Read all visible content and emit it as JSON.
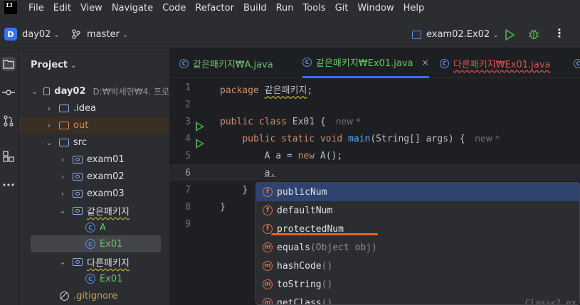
{
  "app_logo": "IJ",
  "menu": [
    "File",
    "Edit",
    "View",
    "Navigate",
    "Code",
    "Refactor",
    "Build",
    "Run",
    "Tools",
    "Git",
    "Window",
    "Help"
  ],
  "toolbar": {
    "project_badge": "D",
    "project_name": "day02",
    "branch_name": "master",
    "run_config": "exam02.Ex02",
    "more_glyph": "⋮"
  },
  "panel": {
    "title": "Project"
  },
  "tree": {
    "root": {
      "name": "day02",
      "path": "D:₩박세현₩4. 프로"
    },
    "idea": ".idea",
    "out": "out",
    "src": "src",
    "exam01": "exam01",
    "exam02": "exam02",
    "exam03": "exam03",
    "pkg_same": "같은패키지",
    "class_a": "A",
    "class_ex01": "Ex01",
    "pkg_other": "다른패키지",
    "class_ex01_other": "Ex01",
    "gitignore": ".gitignore"
  },
  "tabs": [
    {
      "label": "같은패키지₩A.java"
    },
    {
      "label": "같은패키지₩Ex01.java",
      "close": "×"
    },
    {
      "label": "다른패키지₩Ex01.java"
    }
  ],
  "lines": [
    "1",
    "2",
    "3",
    "4",
    "5",
    "6",
    "7",
    "8",
    "9"
  ],
  "code": {
    "l1_kw": "package",
    "l1_rest": "같은패키지",
    "l1_end": ";",
    "l3_kw": "public class",
    "l3_rest": " Ex01 {",
    "l3_hint": "new *",
    "l4_kw": "public static void",
    "l4_fn": "main",
    "l4_rest": "(String[] args) {",
    "l4_hint": "new *",
    "l5_a": "A a = ",
    "l5_kw": "new",
    "l5_rest": " A();",
    "l6": "a.",
    "l7": "}",
    "l8": "}"
  },
  "completion": [
    {
      "icon": "f",
      "name": "publicNum",
      "params": "",
      "type": ""
    },
    {
      "icon": "f",
      "name": "defaultNum",
      "params": "",
      "type": ""
    },
    {
      "icon": "f",
      "name": "protectedNum",
      "params": "",
      "type": ""
    },
    {
      "icon": "m",
      "name": "equals",
      "params": "(Object obj)",
      "type": ""
    },
    {
      "icon": "m",
      "name": "hashCode",
      "params": "()",
      "type": ""
    },
    {
      "icon": "m",
      "name": "toString",
      "params": "()",
      "type": ""
    },
    {
      "icon": "m",
      "name": "getClass",
      "params": "()",
      "type": "Class<? ex"
    }
  ],
  "colors": {
    "accent": "#3574f0",
    "keyword": "#cf8e6d",
    "function": "#56a8f5",
    "run": "#4fa24f",
    "annotation": "#e8651c"
  }
}
